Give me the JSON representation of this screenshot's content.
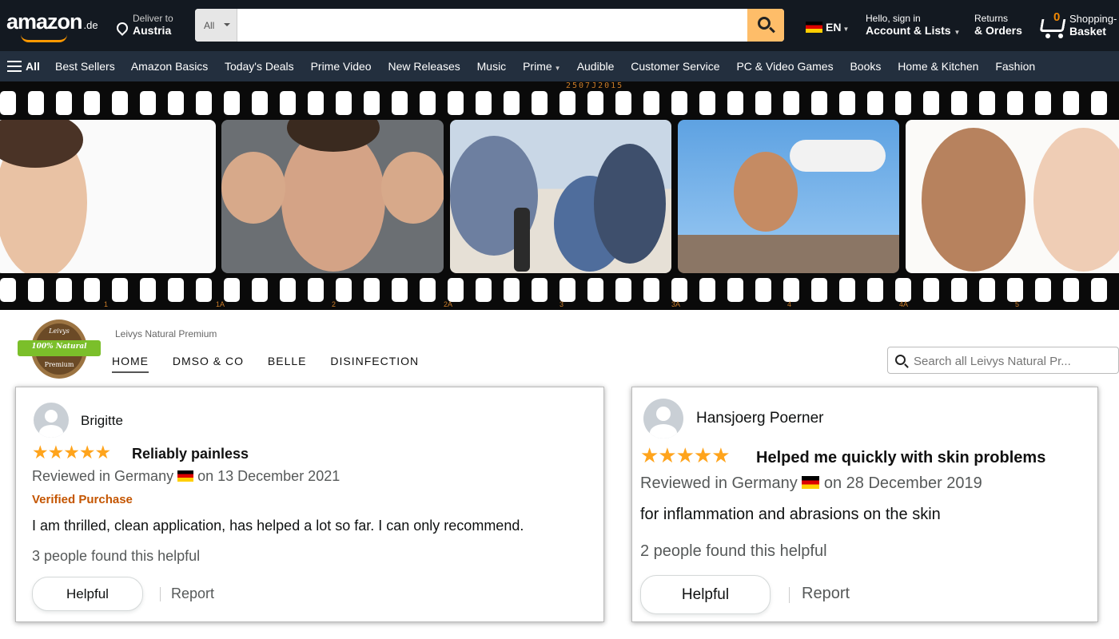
{
  "header": {
    "logo": "amazon",
    "logo_tld": ".de",
    "deliver_line1": "Deliver to",
    "deliver_line2": "Austria",
    "search_category": "All",
    "search_placeholder": "",
    "language": "EN",
    "account_line1": "Hello, sign in",
    "account_line2": "Account & Lists",
    "returns_line1": "Returns",
    "returns_line2": "& Orders",
    "cart_count": "0",
    "cart_line1": "Shopping-",
    "cart_line2": "Basket"
  },
  "subnav": {
    "all_label": "All",
    "links": [
      "Best Sellers",
      "Amazon Basics",
      "Today's Deals",
      "Prime Video",
      "New Releases",
      "Music",
      "Prime",
      "Audible",
      "Customer Service",
      "PC & Video Games",
      "Books",
      "Home & Kitchen",
      "Fashion"
    ]
  },
  "filmstrip": {
    "code": "2507J2015",
    "frame_numbers": [
      "1",
      "1A",
      "2",
      "2A",
      "3",
      "3A",
      "4",
      "4A",
      "5"
    ]
  },
  "store": {
    "badge_top": "Leivys",
    "badge_ribbon": "100% Natural",
    "badge_bottom": "Premium",
    "brand_name": "Leivys Natural Premium",
    "tabs": [
      "HOME",
      "DMSO & CO",
      "BELLE",
      "DISINFECTION"
    ],
    "active_tab": "HOME",
    "search_placeholder": "Search all Leivys Natural Pr..."
  },
  "reviews": [
    {
      "reviewer": "Brigitte",
      "stars": "★★★★★",
      "rating": 5,
      "title": "Reliably painless",
      "meta_prefix": "Reviewed in Germany",
      "meta_suffix": "on 13 December 2021",
      "verified": "Verified Purchase",
      "body": "I am thrilled, clean application, has helped a lot so far. I can only recommend.",
      "helpful_count": "3 people found this helpful",
      "helpful_button": "Helpful",
      "report": "Report"
    },
    {
      "reviewer": "Hansjoerg Poerner",
      "stars": "★★★★★",
      "rating": 5,
      "title": "Helped me quickly with skin problems",
      "meta_prefix": "Reviewed in Germany",
      "meta_suffix": "on 28 December 2019",
      "body": "for inflammation and abrasions on the skin",
      "helpful_count": "2 people found this helpful",
      "helpful_button": "Helpful",
      "report": "Report"
    }
  ],
  "colors": {
    "nav_bg": "#131921",
    "subnav_bg": "#232f3e",
    "search_button": "#febd69",
    "star": "#ffa41c",
    "verified": "#c45500",
    "film_accent": "#c97b28"
  }
}
